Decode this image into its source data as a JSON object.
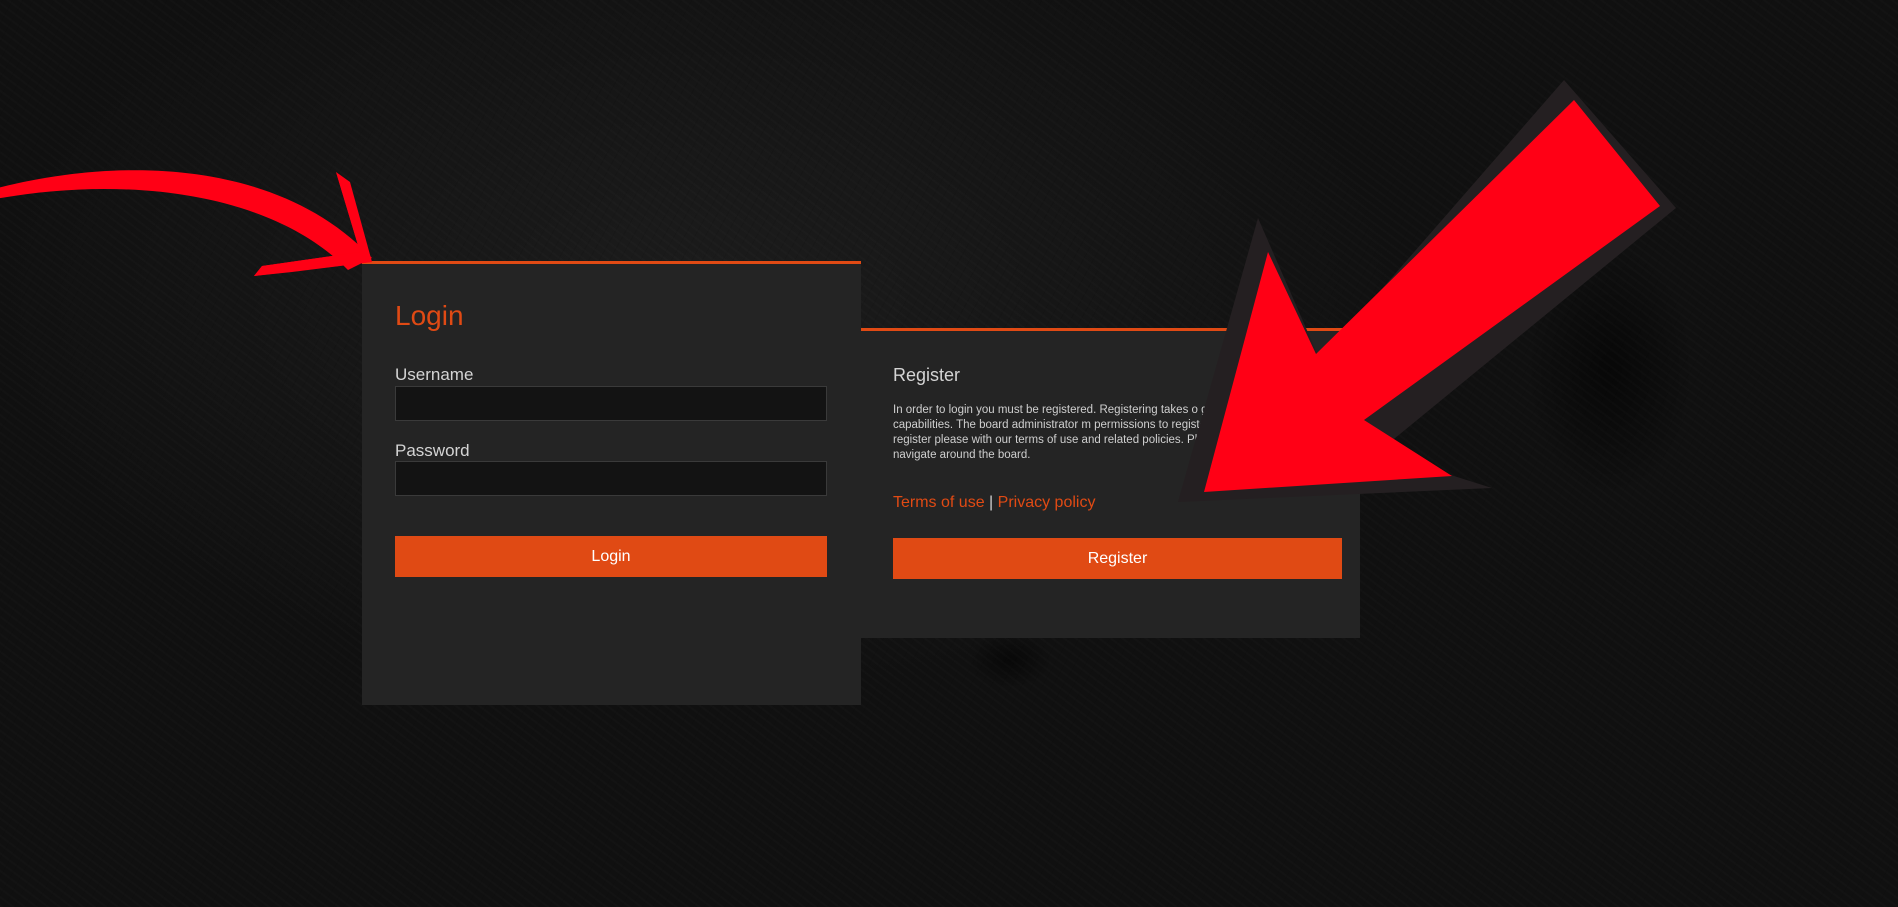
{
  "login": {
    "title": "Login",
    "username_label": "Username",
    "username_value": "",
    "password_label": "Password",
    "password_value": "",
    "submit_label": "Login"
  },
  "register": {
    "title": "Register",
    "description": "In order to login you must be registered. Registering takes o gives you increased capabilities. The board administrator m permissions to registered users. Before you register please with our terms of use and related policies. Please ensure as you navigate around the board.",
    "terms_link": "Terms of use",
    "separator": "|",
    "privacy_link": "Privacy policy",
    "submit_label": "Register"
  },
  "colors": {
    "accent": "#e04a14",
    "panel": "#242424",
    "background": "#121212",
    "annotation_arrow": "#ff0015"
  }
}
